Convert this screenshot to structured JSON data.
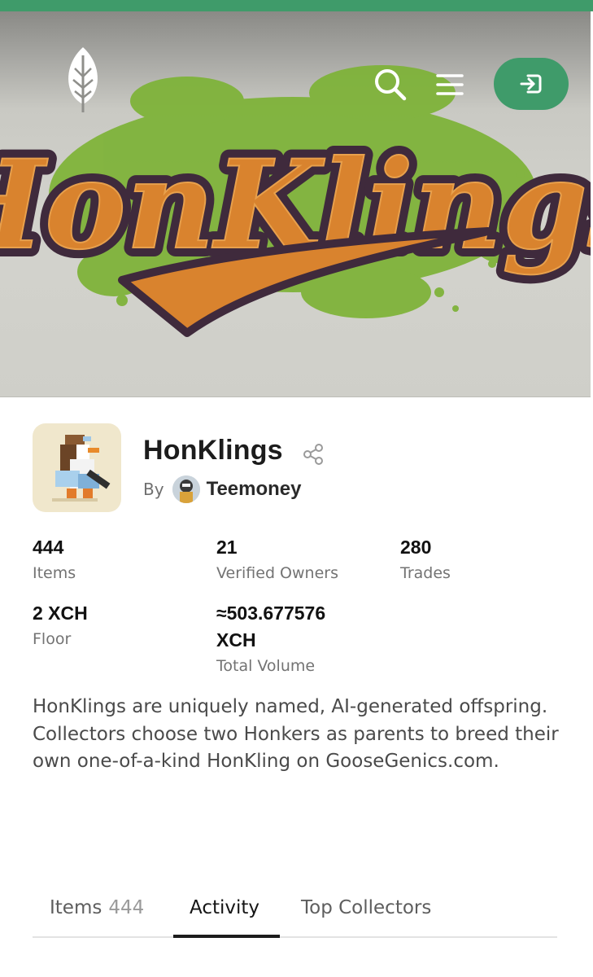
{
  "collection": {
    "name": "HonKlings",
    "by_label": "By",
    "creator": "Teemoney",
    "description": "HonKlings are uniquely named, AI-generated offspring. Collectors choose two Honkers as parents to breed their own one-of-a-kind HonKling on GooseGenics.com."
  },
  "banner": {
    "artwork_text": "HonKlings"
  },
  "stats": {
    "items": {
      "value": "444",
      "label": "Items"
    },
    "owners": {
      "value": "21",
      "label": "Verified Owners"
    },
    "trades": {
      "value": "280",
      "label": "Trades"
    },
    "floor": {
      "value": "2 XCH",
      "label": "Floor"
    },
    "volume": {
      "value": "≈503.677576 XCH",
      "label": "Total Volume"
    }
  },
  "tabs": [
    {
      "label": "Items",
      "count": "444",
      "active": false
    },
    {
      "label": "Activity",
      "count": "",
      "active": true
    },
    {
      "label": "Top Collectors",
      "count": "",
      "active": false
    }
  ],
  "icons": {
    "logo": "leaf-logo-icon",
    "search": "search-icon",
    "menu": "hamburger-menu-icon",
    "login": "login-icon",
    "share": "share-icon"
  },
  "colors": {
    "brand_green": "#3f9b6a",
    "banner_orange": "#d9832e",
    "banner_outline": "#3f2a3c",
    "splash_green": "#7fb33a"
  }
}
